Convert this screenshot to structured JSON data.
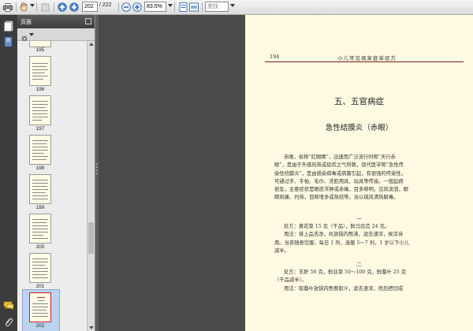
{
  "toolbar": {
    "page_current": "202",
    "page_total": "/ 222",
    "zoom": "83.5%",
    "search_placeholder": "查找"
  },
  "panel": {
    "title": "页面"
  },
  "thumbnails": [
    {
      "label": "195"
    },
    {
      "label": "196"
    },
    {
      "label": "197"
    },
    {
      "label": "198"
    },
    {
      "label": "199"
    },
    {
      "label": "200"
    },
    {
      "label": "201"
    },
    {
      "label": "202"
    }
  ],
  "page": {
    "page_number": "194",
    "book_title": "小儿常见病家庭单验方",
    "chapter": "五、五官病症",
    "section": "急性结膜炎（赤眼）",
    "intro_lines": [
      "赤眼，俗称“红眼睛”，迅速而广泛流行时称“天行赤",
      "眼”，是由于外感风热或疫疠之气所致，现代医学称“急性传",
      "染性结膜炎”，是由感染病毒或病菌引起，有很强的传染性，",
      "可通过手、手帕、毛巾、洗脸用具、玩具等传染。一般起病",
      "很急，主要症状是眼皮浮肿或赤痛，目多眵明，见风流泪，眼",
      "睛刺痛、灼热，目眵增多或热结等。治以疏风清热解毒。"
    ],
    "rx1_number": "一",
    "rx1_lines": [
      "处方：黄花菜 15 克（干品），鲜马齿苋 24 克。",
      "用法：将上品洗净，共放锅内熬沸，滤去渣滓，候凉待",
      "用。当茶随意饮服，每日 1 剂，连服 5～7 剂，1 岁以下小儿",
      "减半。"
    ],
    "rx2_number": "二",
    "rx2_lines": [
      "处方：羊肝 50 克，鲜韭菜 50～100 克，鲜桑叶 25 克",
      "（干品减半）。",
      "用法：取桑叶放锅内熬煮取汁，滤去渣滓，然后把切成"
    ]
  }
}
